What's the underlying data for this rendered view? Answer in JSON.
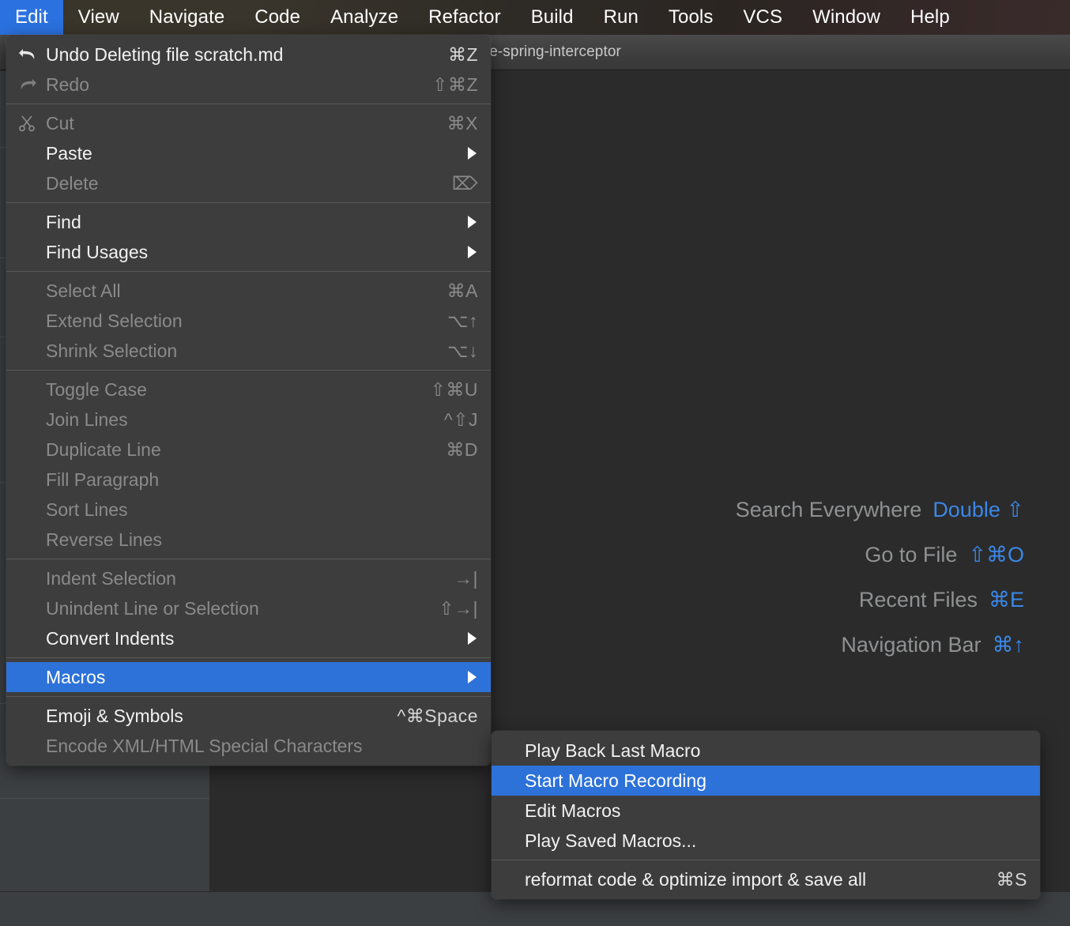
{
  "menubar": {
    "items": [
      {
        "label": "Edit",
        "active": true
      },
      {
        "label": "View",
        "active": false
      },
      {
        "label": "Navigate",
        "active": false
      },
      {
        "label": "Code",
        "active": false
      },
      {
        "label": "Analyze",
        "active": false
      },
      {
        "label": "Refactor",
        "active": false
      },
      {
        "label": "Build",
        "active": false
      },
      {
        "label": "Run",
        "active": false
      },
      {
        "label": "Tools",
        "active": false
      },
      {
        "label": "VCS",
        "active": false
      },
      {
        "label": "Window",
        "active": false
      },
      {
        "label": "Help",
        "active": false
      }
    ]
  },
  "window": {
    "title": "sample-spring-interceptor"
  },
  "editor_hints": [
    {
      "label": "Search Everywhere",
      "shortcut": "Double ⇧"
    },
    {
      "label": "Go to File",
      "shortcut": "⇧⌘O"
    },
    {
      "label": "Recent Files",
      "shortcut": "⌘E"
    },
    {
      "label": "Navigation Bar",
      "shortcut": "⌘↑"
    }
  ],
  "edit_menu": {
    "groups": [
      {
        "items": [
          {
            "label": "Undo Deleting file scratch.md",
            "shortcut": "⌘Z",
            "icon": "undo-icon",
            "disabled": false,
            "submenu": false,
            "selected": false
          },
          {
            "label": "Redo",
            "shortcut": "⇧⌘Z",
            "icon": "redo-icon",
            "disabled": true,
            "submenu": false,
            "selected": false
          }
        ]
      },
      {
        "items": [
          {
            "label": "Cut",
            "shortcut": "⌘X",
            "icon": "scissors-icon",
            "disabled": true,
            "submenu": false,
            "selected": false
          },
          {
            "label": "Paste",
            "shortcut": "",
            "icon": "",
            "disabled": false,
            "submenu": true,
            "selected": false
          },
          {
            "label": "Delete",
            "shortcut": "⌦",
            "icon": "",
            "disabled": true,
            "submenu": false,
            "selected": false
          }
        ]
      },
      {
        "items": [
          {
            "label": "Find",
            "shortcut": "",
            "icon": "",
            "disabled": false,
            "submenu": true,
            "selected": false
          },
          {
            "label": "Find Usages",
            "shortcut": "",
            "icon": "",
            "disabled": false,
            "submenu": true,
            "selected": false
          }
        ]
      },
      {
        "items": [
          {
            "label": "Select All",
            "shortcut": "⌘A",
            "icon": "",
            "disabled": true,
            "submenu": false,
            "selected": false
          },
          {
            "label": "Extend Selection",
            "shortcut": "⌥↑",
            "icon": "",
            "disabled": true,
            "submenu": false,
            "selected": false
          },
          {
            "label": "Shrink Selection",
            "shortcut": "⌥↓",
            "icon": "",
            "disabled": true,
            "submenu": false,
            "selected": false
          }
        ]
      },
      {
        "items": [
          {
            "label": "Toggle Case",
            "shortcut": "⇧⌘U",
            "icon": "",
            "disabled": true,
            "submenu": false,
            "selected": false
          },
          {
            "label": "Join Lines",
            "shortcut": "^⇧J",
            "icon": "",
            "disabled": true,
            "submenu": false,
            "selected": false
          },
          {
            "label": "Duplicate Line",
            "shortcut": "⌘D",
            "icon": "",
            "disabled": true,
            "submenu": false,
            "selected": false
          },
          {
            "label": "Fill Paragraph",
            "shortcut": "",
            "icon": "",
            "disabled": true,
            "submenu": false,
            "selected": false
          },
          {
            "label": "Sort Lines",
            "shortcut": "",
            "icon": "",
            "disabled": true,
            "submenu": false,
            "selected": false
          },
          {
            "label": "Reverse Lines",
            "shortcut": "",
            "icon": "",
            "disabled": true,
            "submenu": false,
            "selected": false
          }
        ]
      },
      {
        "items": [
          {
            "label": "Indent Selection",
            "shortcut": "→|",
            "icon": "",
            "disabled": true,
            "submenu": false,
            "selected": false
          },
          {
            "label": "Unindent Line or Selection",
            "shortcut": "⇧→|",
            "icon": "",
            "disabled": true,
            "submenu": false,
            "selected": false
          },
          {
            "label": "Convert Indents",
            "shortcut": "",
            "icon": "",
            "disabled": false,
            "submenu": true,
            "selected": false
          }
        ]
      },
      {
        "items": [
          {
            "label": "Macros",
            "shortcut": "",
            "icon": "",
            "disabled": false,
            "submenu": true,
            "selected": true
          }
        ]
      },
      {
        "items": [
          {
            "label": "Emoji & Symbols",
            "shortcut": "^⌘Space",
            "icon": "",
            "disabled": false,
            "submenu": false,
            "selected": false
          },
          {
            "label": "Encode XML/HTML Special Characters",
            "shortcut": "",
            "icon": "",
            "disabled": true,
            "submenu": false,
            "selected": false
          }
        ]
      }
    ]
  },
  "macros_submenu": {
    "groups": [
      {
        "items": [
          {
            "label": "Play Back Last Macro",
            "shortcut": "",
            "disabled": false,
            "submenu": false,
            "selected": false
          },
          {
            "label": "Start Macro Recording",
            "shortcut": "",
            "disabled": false,
            "submenu": false,
            "selected": true
          },
          {
            "label": "Edit Macros",
            "shortcut": "",
            "disabled": false,
            "submenu": false,
            "selected": false
          },
          {
            "label": "Play Saved Macros...",
            "shortcut": "",
            "disabled": false,
            "submenu": false,
            "selected": false
          }
        ]
      },
      {
        "items": [
          {
            "label": "reformat code & optimize import & save all",
            "shortcut": "⌘S",
            "disabled": false,
            "submenu": false,
            "selected": false
          }
        ]
      }
    ]
  },
  "colors": {
    "accent": "#2d72d9",
    "menubar_accent": "#2b72e0",
    "menu_bg": "#3d3d3d",
    "editor_bg": "#2b2b2b",
    "hint_key": "#3b87e8"
  }
}
